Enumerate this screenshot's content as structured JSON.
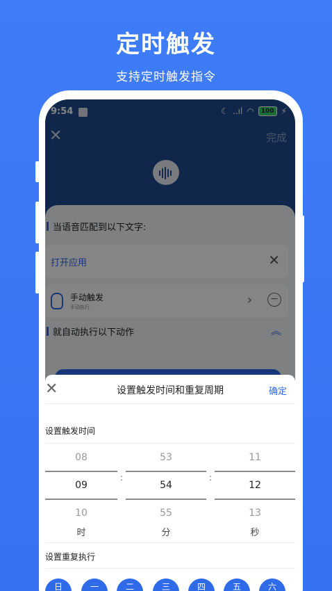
{
  "promo": {
    "title": "定时触发",
    "subtitle": "支持定时触发指令"
  },
  "status_bar": {
    "time": "9:54",
    "signal": "..ıl",
    "battery": "100"
  },
  "header": {
    "done": "完成"
  },
  "rule": {
    "match_label": "当语音匹配到以下文字:",
    "open_app": "打开应用",
    "trigger_title": "手动触发",
    "trigger_sub": "手动执行",
    "action_label": "就自动执行以下动作"
  },
  "sheet": {
    "title": "设置触发时间和重复周期",
    "confirm": "确定",
    "time_label": "设置触发时间",
    "repeat_label": "设置重复执行",
    "hours": {
      "prev": "08",
      "selected": "09",
      "next": "10",
      "unit": "时"
    },
    "minutes": {
      "prev": "53",
      "selected": "54",
      "next": "55",
      "unit": "分"
    },
    "seconds": {
      "prev": "11",
      "selected": "12",
      "next": "13",
      "unit": "秒"
    },
    "separator": ":",
    "days": [
      "日",
      "一",
      "二",
      "三",
      "四",
      "五",
      "六"
    ]
  },
  "colors": {
    "background": "#3f7cf7",
    "header": "#1f4a8e",
    "accent": "#2f6ae8"
  }
}
